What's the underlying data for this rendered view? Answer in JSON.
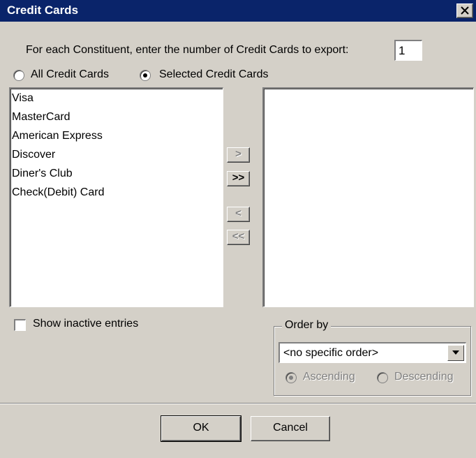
{
  "window": {
    "title": "Credit Cards",
    "close_icon": "close-icon"
  },
  "count_prompt": {
    "label": "For each Constituent, enter the number of Credit Cards to export:",
    "value": "1"
  },
  "selection_mode": {
    "options": [
      {
        "label": "All Credit Cards",
        "selected": false
      },
      {
        "label": "Selected Credit Cards",
        "selected": true
      }
    ]
  },
  "available_list": {
    "items": [
      "Visa",
      "MasterCard",
      "American Express",
      "Discover",
      "Diner's Club",
      "Check(Debit) Card"
    ]
  },
  "selected_list": {
    "items": []
  },
  "move_buttons": {
    "add_one": ">",
    "add_all": ">>",
    "remove_one": "<",
    "remove_all": "<<"
  },
  "show_inactive": {
    "label": "Show inactive entries",
    "checked": false
  },
  "order_by": {
    "legend": "Order by",
    "selected": "<no specific order>",
    "directions": [
      {
        "label": "Ascending",
        "selected": true,
        "enabled": false
      },
      {
        "label": "Descending",
        "selected": false,
        "enabled": false
      }
    ]
  },
  "footer": {
    "ok_label": "OK",
    "cancel_label": "Cancel"
  },
  "colors": {
    "titlebar": "#0a246a",
    "dialog_face": "#d4d0c8",
    "disabled_text": "#808080"
  }
}
